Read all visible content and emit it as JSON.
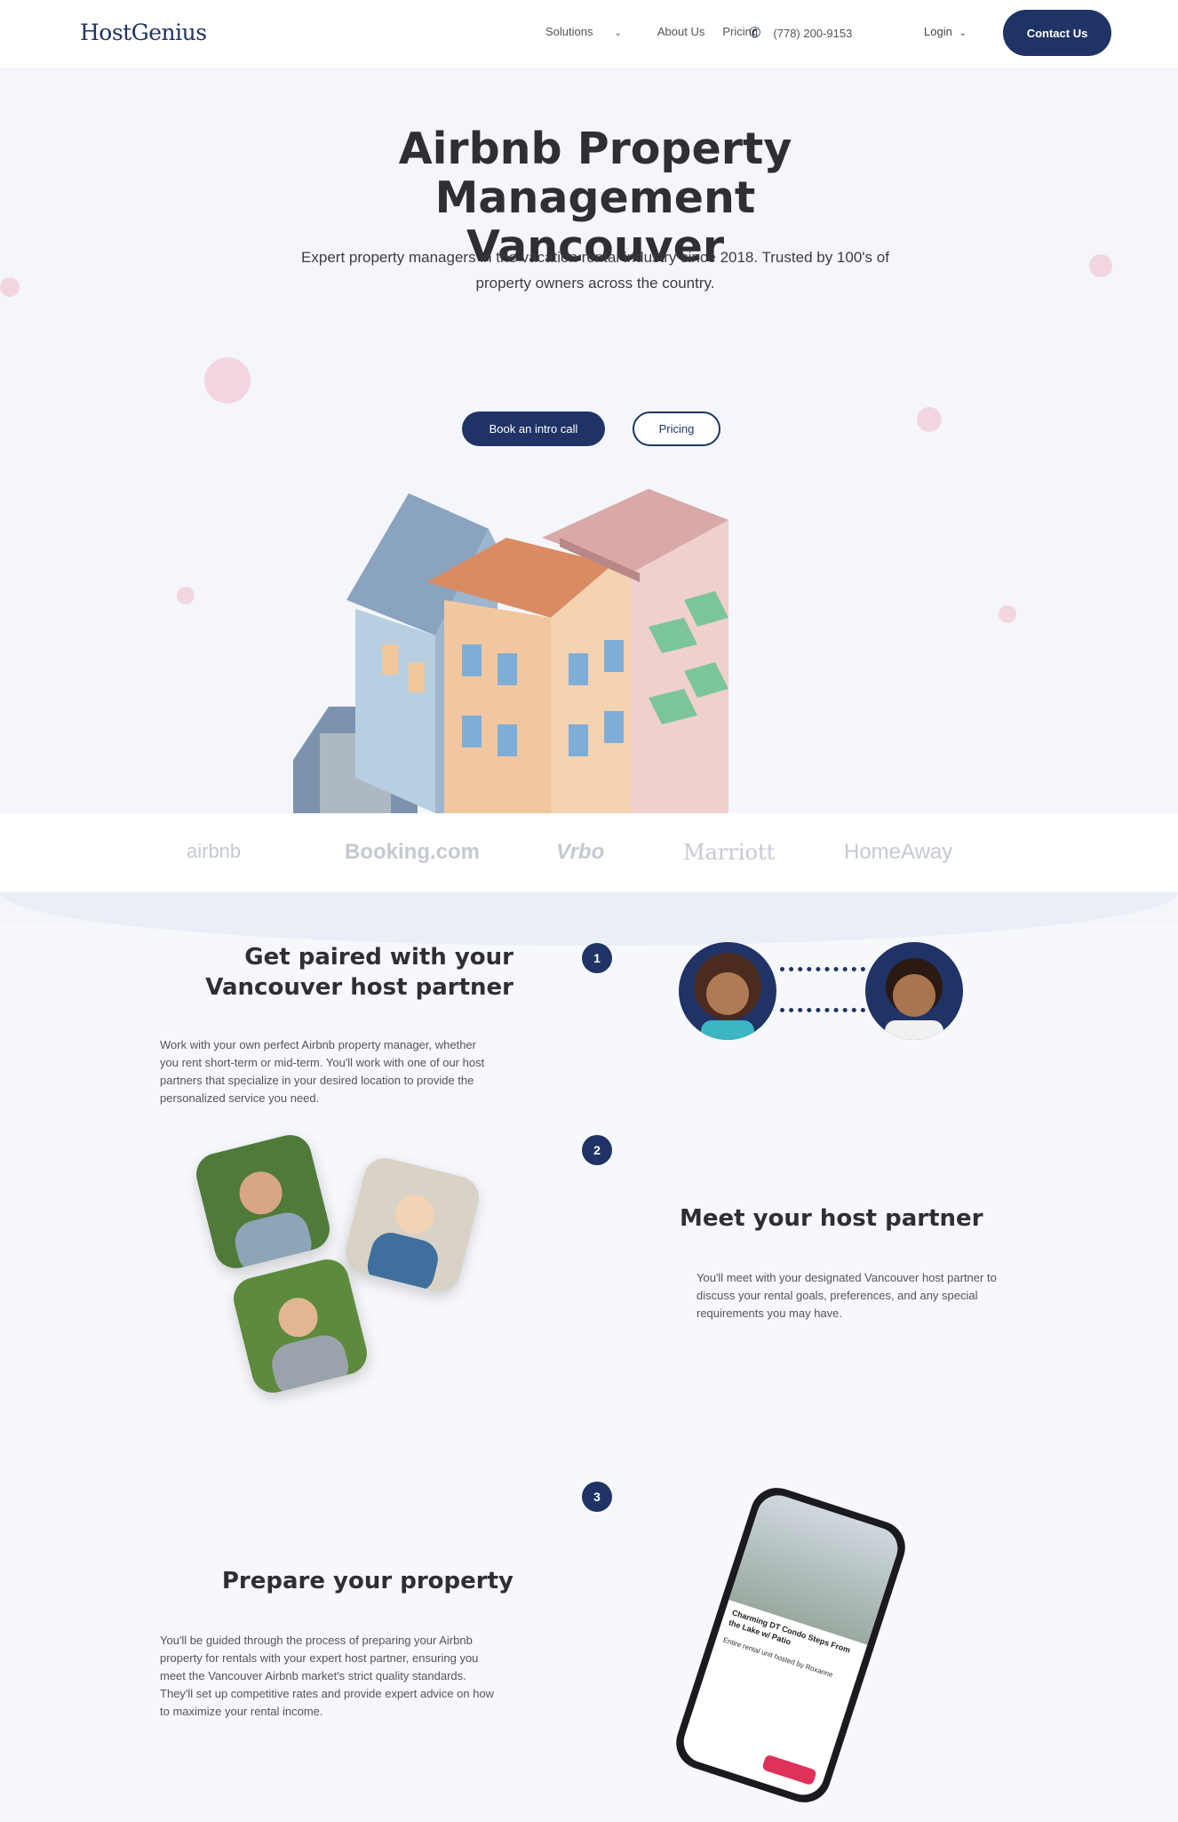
{
  "nav": {
    "logo": "HostGenius",
    "solutions": "Solutions",
    "about": "About Us",
    "pricing": "Pricing",
    "phone": "(778) 200-9153",
    "login": "Login",
    "contact": "Contact Us"
  },
  "hero": {
    "title_line1": "Airbnb Property Management",
    "title_line2": "Vancouver",
    "subtitle_line1": "Expert property managers in the vacation rental industry since 2018. Trusted by 100's of",
    "subtitle_line2": "property owners across the country.",
    "cta_primary": "Book an intro call",
    "cta_secondary": "Pricing"
  },
  "logos": [
    "airbnb",
    "Booking.com",
    "Vrbo",
    "Marriott",
    "HomeAway"
  ],
  "steps": [
    {
      "number": "1",
      "title_line1": "Get paired with your",
      "title_line2": "Vancouver host partner",
      "text": "Work with your own perfect Airbnb property manager, whether you rent short-term or mid-term. You'll work with one of our host partners that specialize in your desired location to provide the personalized service you need."
    },
    {
      "number": "2",
      "title_line1": "Meet your host partner",
      "text": "You'll meet with your designated Vancouver host partner to discuss your rental goals, preferences, and any special requirements you may have."
    },
    {
      "number": "3",
      "title_line1": "Prepare your property",
      "text": "You'll be guided through the process of preparing your Airbnb property for rentals with your expert host partner, ensuring you meet the Vancouver Airbnb market's strict quality standards. They'll set up competitive rates and provide expert advice on how to maximize your rental income."
    }
  ],
  "phone_mockup": {
    "listing_title": "Charming DT Condo Steps From the Lake w/ Patio",
    "host_line": "Entire rental unit hosted by Roxanne"
  },
  "colors": {
    "brand_navy": "#1f3366",
    "background": "#f4f6fb",
    "accent_pink": "#f1d6e0"
  }
}
